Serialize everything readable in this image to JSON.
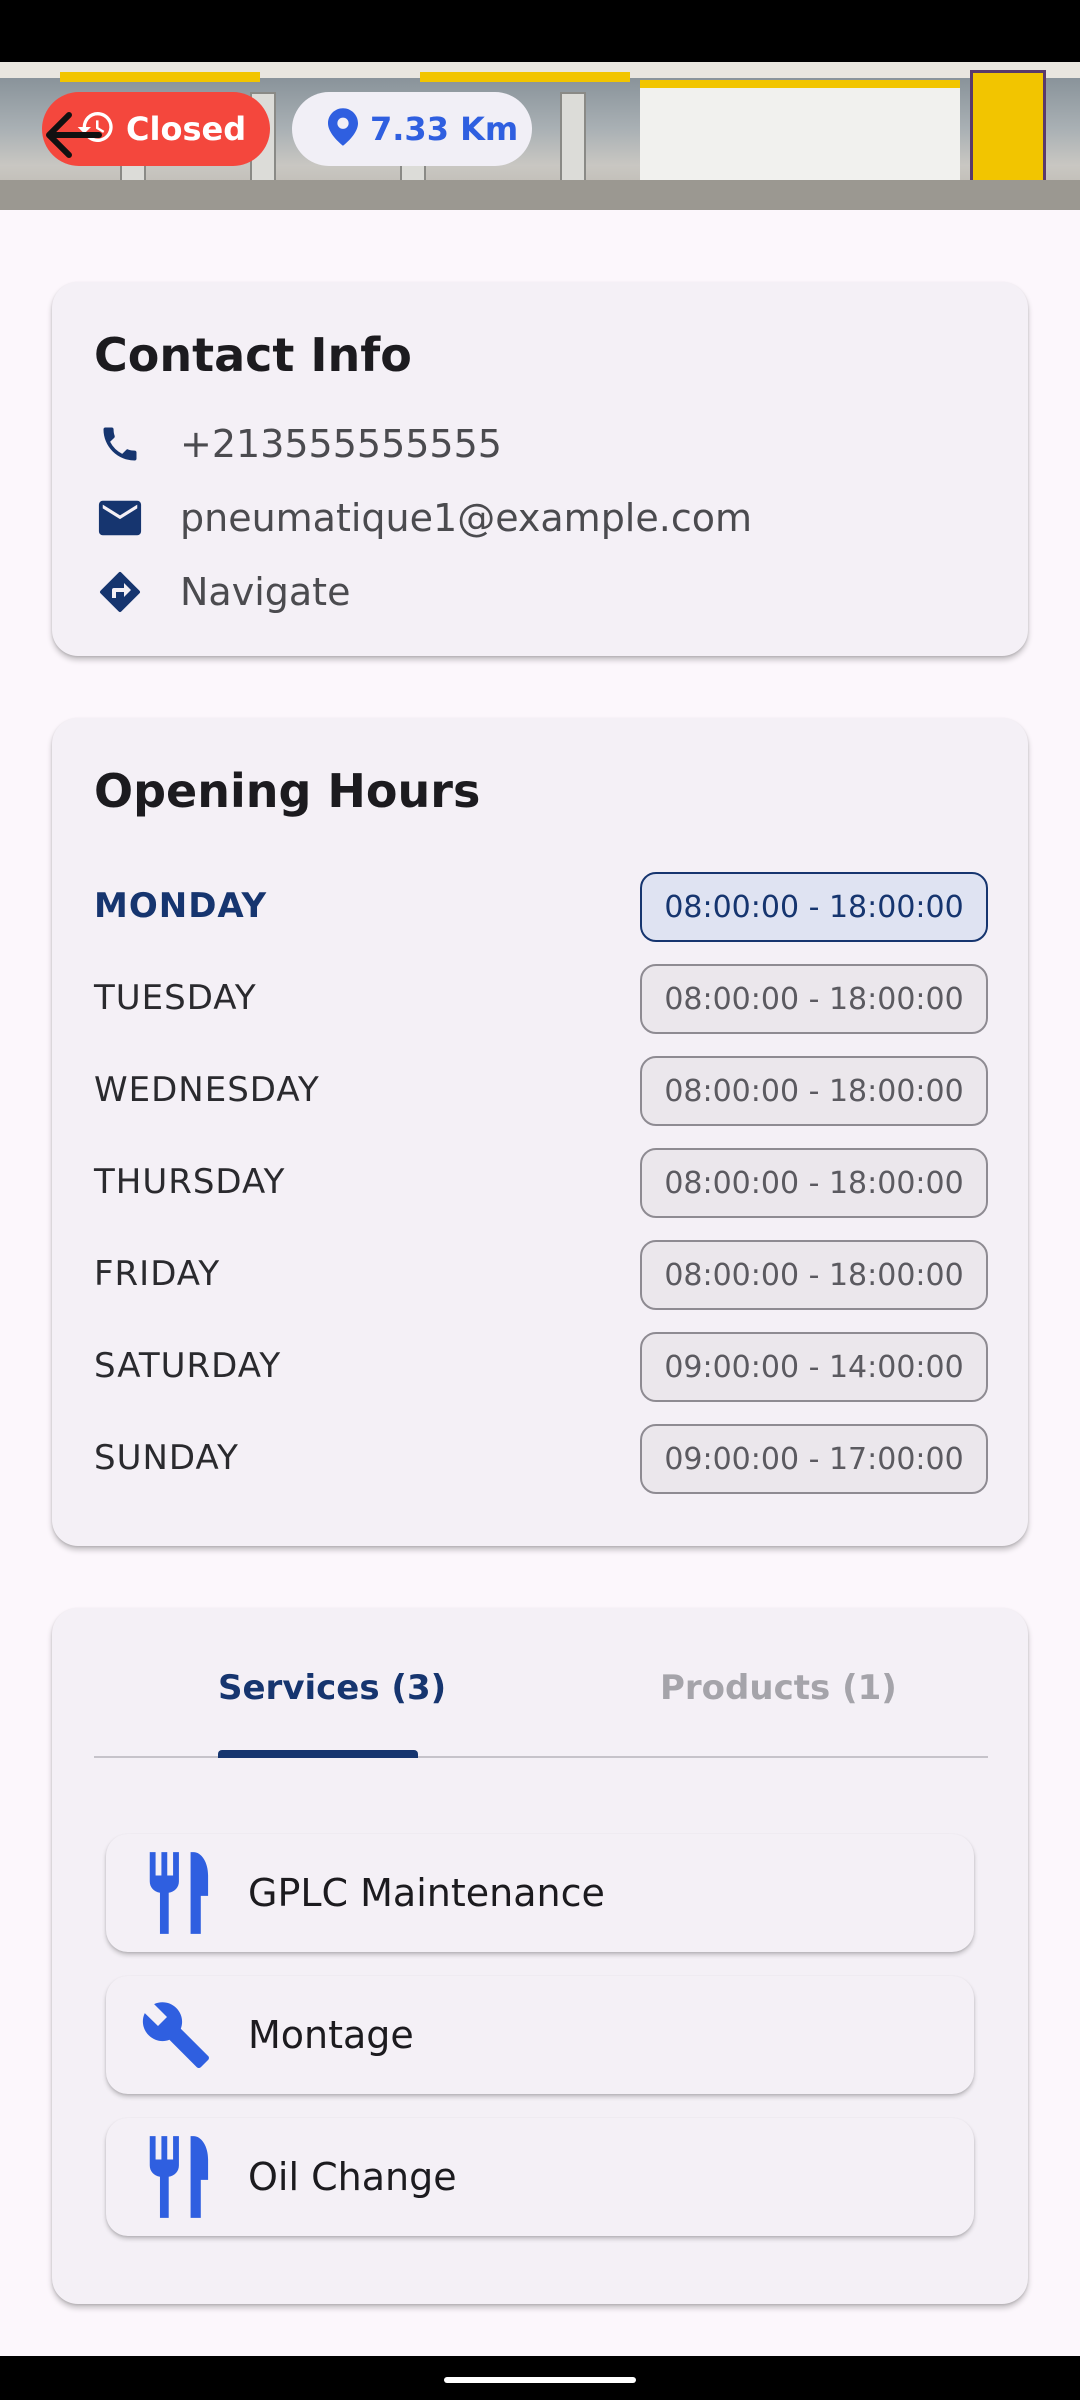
{
  "header": {
    "status_chip": {
      "label": "Closed",
      "icon": "clock-history-icon",
      "color": "#f4473d"
    },
    "distance_chip": {
      "label": "7.33 Km",
      "icon": "location-pin-icon",
      "color": "#2f5fe0"
    },
    "back_icon": "arrow-back-icon"
  },
  "contact": {
    "title": "Contact Info",
    "phone": "+213555555555",
    "email": "pneumatique1@example.com",
    "navigate": "Navigate"
  },
  "hours": {
    "title": "Opening Hours",
    "days": [
      {
        "day": "MONDAY",
        "time": "08:00:00 - 18:00:00",
        "today": true
      },
      {
        "day": "TUESDAY",
        "time": "08:00:00 - 18:00:00",
        "today": false
      },
      {
        "day": "WEDNESDAY",
        "time": "08:00:00 - 18:00:00",
        "today": false
      },
      {
        "day": "THURSDAY",
        "time": "08:00:00 - 18:00:00",
        "today": false
      },
      {
        "day": "FRIDAY",
        "time": "08:00:00 - 18:00:00",
        "today": false
      },
      {
        "day": "SATURDAY",
        "time": "09:00:00 - 14:00:00",
        "today": false
      },
      {
        "day": "SUNDAY",
        "time": "09:00:00 - 17:00:00",
        "today": false
      }
    ]
  },
  "tabs": {
    "services_label": "Services (3)",
    "products_label": "Products (1)",
    "active": "services"
  },
  "services": [
    {
      "label": "GPLC Maintenance",
      "icon": "restaurant-icon"
    },
    {
      "label": "Montage",
      "icon": "wrench-icon"
    },
    {
      "label": "Oil Change",
      "icon": "restaurant-icon"
    }
  ],
  "colors": {
    "primary": "#16356f",
    "accent_blue": "#2f5fe0",
    "closed_red": "#f4473d",
    "card_bg": "#f4f0f6",
    "page_bg": "#fcf7fc"
  }
}
